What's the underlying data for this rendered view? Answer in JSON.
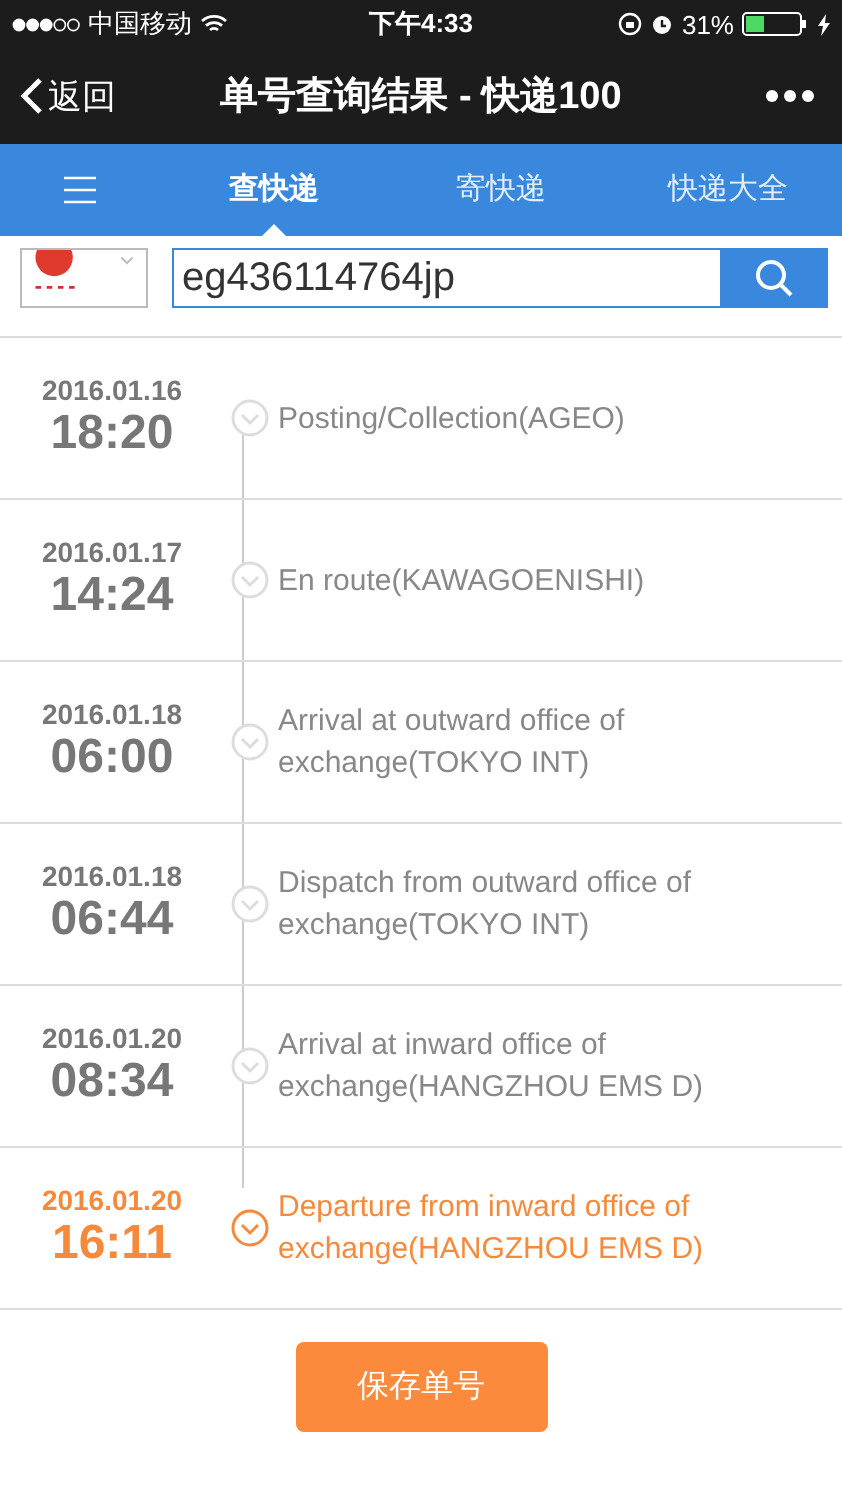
{
  "status_bar": {
    "carrier": "中国移动",
    "time": "下午4:33",
    "battery": "31%"
  },
  "nav_bar": {
    "back": "返回",
    "title": "单号查询结果 - 快递100"
  },
  "tabs": [
    {
      "label": "查快递",
      "selected": true
    },
    {
      "label": "寄快递",
      "selected": false
    },
    {
      "label": "快递大全",
      "selected": false
    }
  ],
  "search": {
    "value": "eg436114764jp"
  },
  "events": [
    {
      "date": "2016.01.16",
      "time": "18:20",
      "description": "Posting/Collection(AGEO)",
      "latest": false
    },
    {
      "date": "2016.01.17",
      "time": "14:24",
      "description": "En route(KAWAGOENISHI)",
      "latest": false
    },
    {
      "date": "2016.01.18",
      "time": "06:00",
      "description": "Arrival at outward office of exchange(TOKYO INT)",
      "latest": false
    },
    {
      "date": "2016.01.18",
      "time": "06:44",
      "description": "Dispatch from outward office of exchange(TOKYO INT)",
      "latest": false
    },
    {
      "date": "2016.01.20",
      "time": "08:34",
      "description": "Arrival at inward office of exchange(HANGZHOU EMS D)",
      "latest": false
    },
    {
      "date": "2016.01.20",
      "time": "16:11",
      "description": "Departure from inward office of exchange(HANGZHOU EMS D)",
      "latest": true
    }
  ],
  "save_button": "保存单号"
}
